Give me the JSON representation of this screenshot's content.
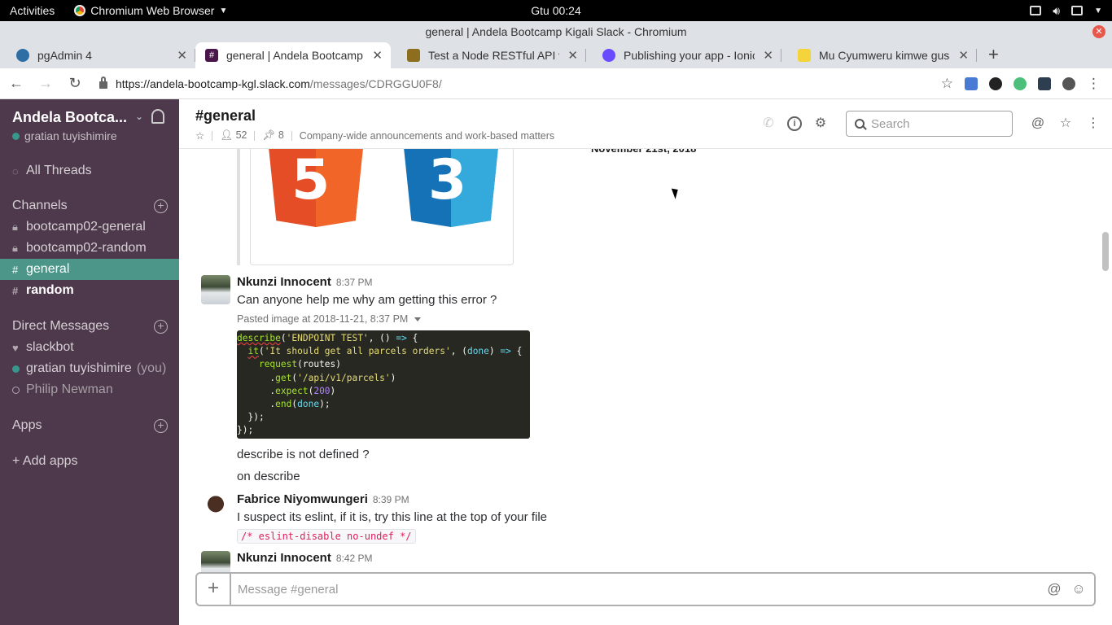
{
  "gnome": {
    "activities": "Activities",
    "app_name": "Chromium Web Browser",
    "clock": "Gtu 00:24"
  },
  "window": {
    "title": "general | Andela Bootcamp Kigali Slack - Chromium"
  },
  "tabs": [
    {
      "title": "pgAdmin 4",
      "favicon_color": "#2f6ea5",
      "active": false
    },
    {
      "title": "general | Andela Bootcamp Kigali Slack",
      "favicon_color": "#4a154b",
      "active": true
    },
    {
      "title": "Test a Node RESTful API with Mocha and Chai",
      "favicon_color": "#8d6e1f",
      "active": false
    },
    {
      "title": "Publishing your app - Ionic",
      "favicon_color": "#6a4cff",
      "active": false
    },
    {
      "title": "Mu Cyumweru kimwe gusa",
      "favicon_color": "#f5d33b",
      "active": false
    }
  ],
  "browser": {
    "url_host": "https://andela-bootcamp-kgl.slack.com",
    "url_path": "/messages/CDRGGU0F8/",
    "ext_colors": [
      "#4a7bd4",
      "#222222",
      "#4cc07a",
      "#2c3e50",
      "#555555"
    ]
  },
  "sidebar": {
    "workspace": "Andela Bootca...",
    "user": "gratian tuyishimire",
    "all_threads": "All Threads",
    "channels_heading": "Channels",
    "channels": [
      {
        "prefix": "lock",
        "name": "bootcamp02-general",
        "state": "normal"
      },
      {
        "prefix": "lock",
        "name": "bootcamp02-random",
        "state": "normal"
      },
      {
        "prefix": "#",
        "name": "general",
        "state": "active"
      },
      {
        "prefix": "#",
        "name": "random",
        "state": "unread"
      }
    ],
    "dm_heading": "Direct Messages",
    "dms": [
      {
        "name": "slackbot",
        "suffix": "",
        "presence": "heart"
      },
      {
        "name": "gratian tuyishimire",
        "suffix": "(you)",
        "presence": "online"
      },
      {
        "name": "Philip Newman",
        "suffix": "",
        "presence": "away"
      }
    ],
    "apps_heading": "Apps",
    "add_apps": "+ Add apps"
  },
  "channel": {
    "name": "#general",
    "members": "52",
    "pinned": "8",
    "topic": "Company-wide announcements and work-based matters",
    "search_placeholder": "Search"
  },
  "messages": {
    "date_divider": "November 21st, 2018",
    "items": [
      {
        "author": "Nkunzi Innocent",
        "time": "8:37 PM",
        "lines": [
          "Can anyone help me  why am getting this error ?"
        ],
        "attachment_label": "Pasted image at 2018-11-21, 8:37 PM",
        "followups": [
          "describe is not defined ?",
          "on describe"
        ]
      },
      {
        "author": "Fabrice Niyomwungeri",
        "time": "8:39 PM",
        "lines": [
          "I suspect its eslint, if it is,  try this line at the top of your file"
        ],
        "code": "/* eslint-disable no-undef */"
      },
      {
        "author": "Nkunzi Innocent",
        "time": "8:42 PM",
        "lines": []
      }
    ],
    "code_image_lines": [
      "describe('ENDPOINT TEST', () => {",
      "  it('It should get all parcels orders', (done) => {",
      "    request(routes)",
      "      .get('/api/v1/parcels')",
      "      .expect(200)",
      "      .end(done);",
      "  });",
      "});"
    ]
  },
  "composer": {
    "placeholder": "Message #general"
  }
}
